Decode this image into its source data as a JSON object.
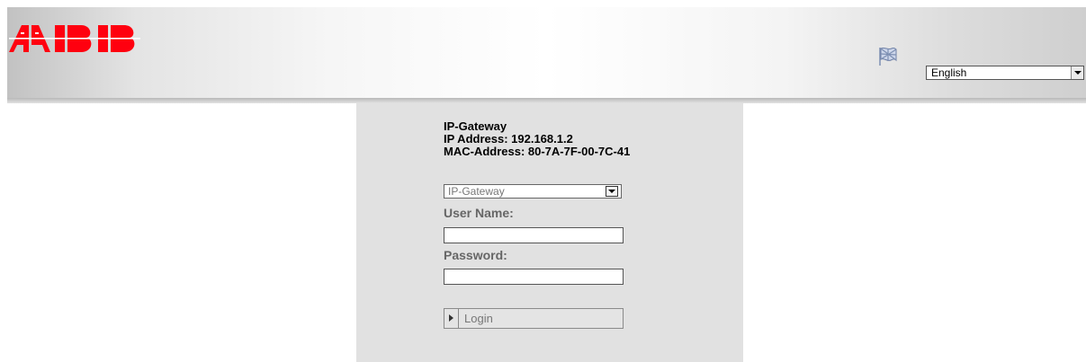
{
  "brand": {
    "logo_text": "ABB",
    "logo_color": "#ff000f"
  },
  "header": {
    "language_icon": "language-flag-icon",
    "language_select": {
      "value": "English"
    }
  },
  "device": {
    "name": "IP-Gateway",
    "ip_address": "IP Address: 192.168.1.2",
    "mac_address": "MAC-Address: 80-7A-7F-00-7C-41"
  },
  "login": {
    "device_select": {
      "value": "IP-Gateway"
    },
    "username_label": "User Name:",
    "username_value": "",
    "password_label": "Password:",
    "password_value": "",
    "login_label": "Login"
  }
}
